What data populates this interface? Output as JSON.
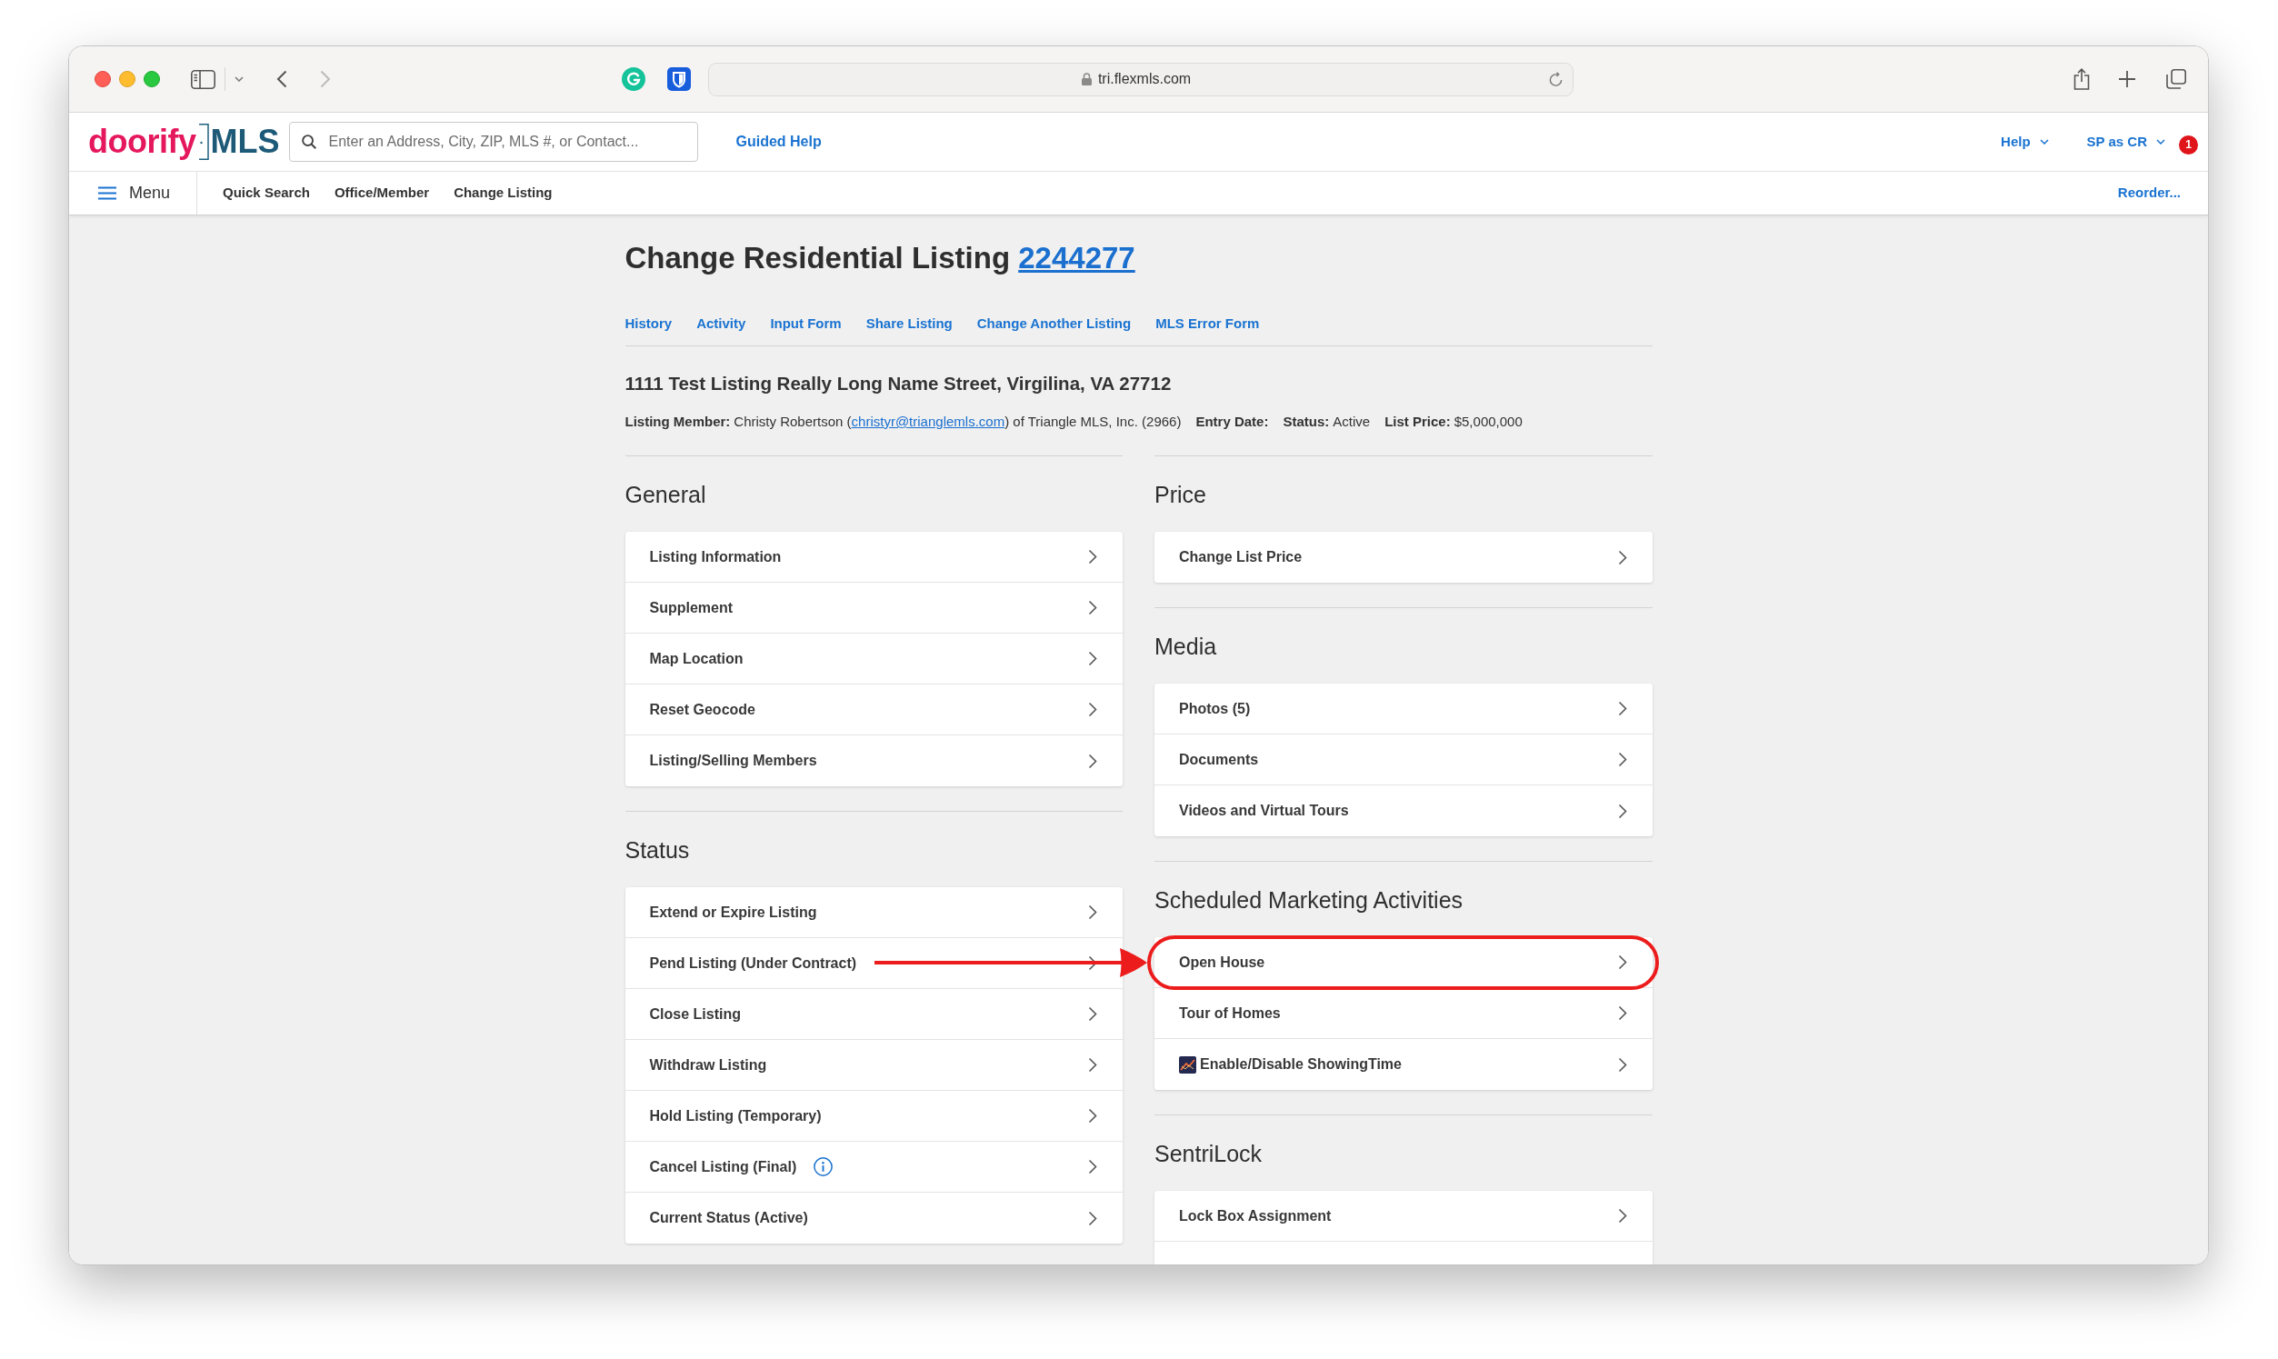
{
  "browser": {
    "url": "tri.flexmls.com"
  },
  "header": {
    "logo": {
      "brand": "doorify",
      "suffix": "MLS"
    },
    "search": {
      "placeholder": "Enter an Address, City, ZIP, MLS #, or Contact..."
    },
    "guided_help": "Guided Help",
    "menus": [
      "Help",
      "SP as CR"
    ],
    "notification_badge": "1"
  },
  "nav": {
    "menu": "Menu",
    "items": [
      "Quick Search",
      "Office/Member",
      "Change Listing"
    ],
    "reorder": "Reorder..."
  },
  "listing": {
    "title": "Change Residential Listing",
    "number": "2244277",
    "links": [
      "History",
      "Activity",
      "Input Form",
      "Share Listing",
      "Change Another Listing",
      "MLS Error Form"
    ],
    "address": "1111 Test Listing Really Long Name Street, Virgilina, VA 27712",
    "details": [
      {
        "label": "Listing Member:",
        "value": "Christy Robertson (",
        "email": "christyr@trianglemls.com",
        "value_after": ") of Triangle MLS, Inc. (2966)"
      },
      {
        "label": "Entry Date:"
      },
      {
        "label": "Status:",
        "value": "Active"
      },
      {
        "label": "List Price:",
        "value": "$5,000,000"
      }
    ]
  },
  "columns": [
    {
      "sections": [
        {
          "heading": "General",
          "items": [
            {
              "label": "Listing Information",
              "kind": "plain",
              "circled": false
            },
            {
              "label": "Supplement",
              "kind": "plain",
              "circled": false
            },
            {
              "label": "Map Location",
              "kind": "plain",
              "circled": false
            },
            {
              "label": "Reset Geocode",
              "kind": "plain",
              "circled": false
            },
            {
              "label": "Listing/Selling Members",
              "kind": "plain",
              "circled": false
            }
          ]
        },
        {
          "heading": "Status",
          "items": [
            {
              "label": "Extend or Expire Listing",
              "kind": "plain",
              "circled": false
            },
            {
              "label": "Pend Listing (Under Contract)",
              "kind": "plain",
              "circled": false
            },
            {
              "label": "Close Listing",
              "kind": "plain",
              "circled": false
            },
            {
              "label": "Withdraw Listing",
              "kind": "plain",
              "circled": false
            },
            {
              "label": "Hold Listing (Temporary)",
              "kind": "plain",
              "circled": false
            },
            {
              "label": "Cancel Listing (Final)",
              "kind": "info",
              "circled": false
            },
            {
              "label": "Current Status (Active)",
              "kind": "plain",
              "circled": false
            }
          ]
        }
      ]
    },
    {
      "sections": [
        {
          "heading": "Price",
          "items": [
            {
              "label": "Change List Price",
              "kind": "plain",
              "circled": false
            }
          ]
        },
        {
          "heading": "Media",
          "items": [
            {
              "label": "Photos (5)",
              "kind": "plain",
              "circled": false
            },
            {
              "label": "Documents",
              "kind": "plain",
              "circled": false
            },
            {
              "label": "Videos and Virtual Tours",
              "kind": "plain",
              "circled": false
            }
          ]
        },
        {
          "heading": "Scheduled Marketing Activities",
          "items": [
            {
              "label": "Open House",
              "kind": "plain",
              "circled": true
            },
            {
              "label": "Tour of Homes",
              "kind": "plain",
              "circled": false
            },
            {
              "label": "Enable/Disable ShowingTime",
              "kind": "app",
              "circled": false
            }
          ]
        },
        {
          "heading": "SentriLock",
          "items": [
            {
              "label": "Lock Box Assignment",
              "kind": "plain",
              "circled": false
            },
            {
              "kind": "clipped"
            }
          ]
        }
      ]
    }
  ]
}
